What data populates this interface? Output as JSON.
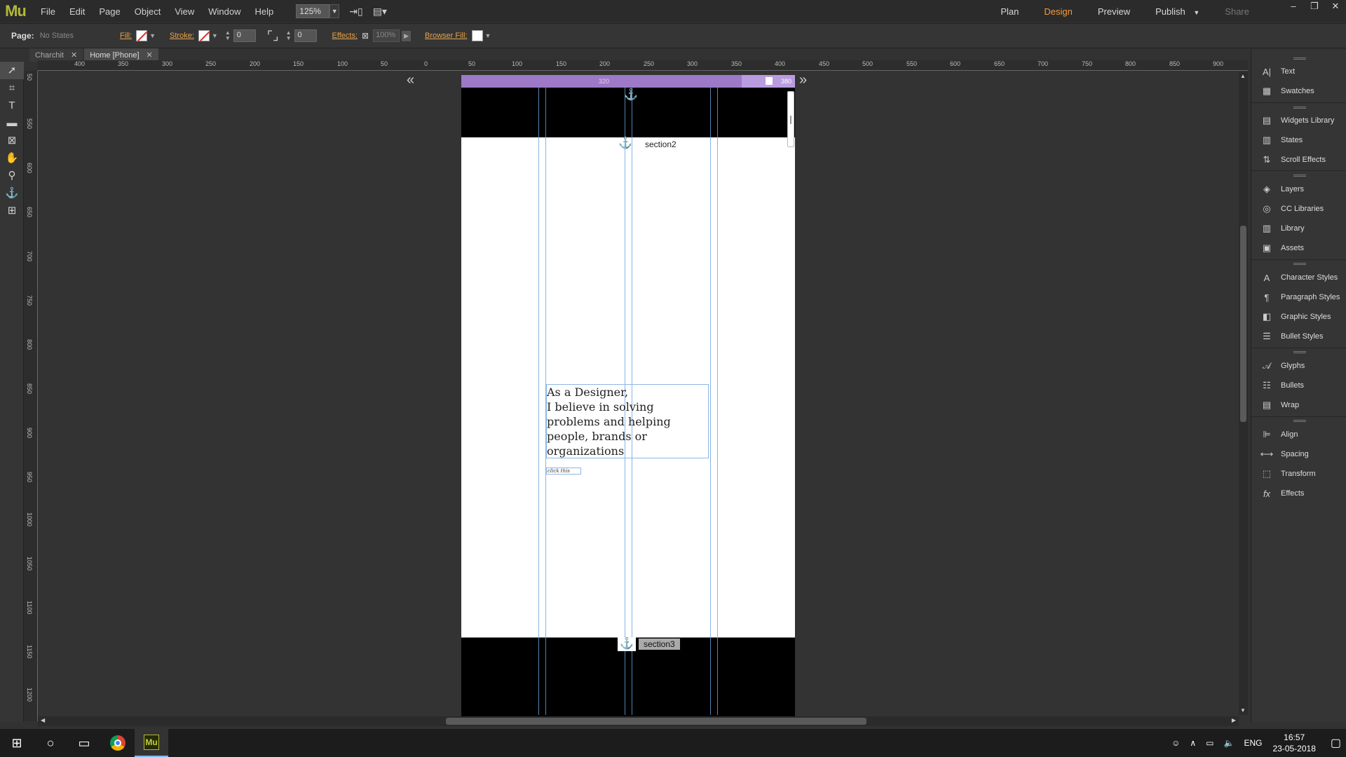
{
  "app": {
    "logo": "Mu"
  },
  "menu": [
    "File",
    "Edit",
    "Page",
    "Object",
    "View",
    "Window",
    "Help"
  ],
  "toolbar": {
    "zoom": "125%"
  },
  "modes": {
    "plan": "Plan",
    "design": "Design",
    "preview": "Preview",
    "publish": "Publish",
    "share": "Share"
  },
  "window_controls": {
    "minimize": "–",
    "restore": "❐",
    "close": "✕"
  },
  "controlbar": {
    "page_label": "Page:",
    "page_state": "No States",
    "fill_label": "Fill:",
    "stroke_label": "Stroke:",
    "stroke_width": "0",
    "corner_radius": "0",
    "effects_label": "Effects:",
    "opacity": "100%",
    "browser_fill_label": "Browser Fill:"
  },
  "tabs": [
    {
      "label": "Charchit",
      "active": false
    },
    {
      "label": "Home [Phone]",
      "active": true
    }
  ],
  "ruler": {
    "horizontal": [
      "400",
      "350",
      "300",
      "250",
      "200",
      "150",
      "100",
      "50",
      "0",
      "50",
      "100",
      "150",
      "200",
      "250",
      "300",
      "350",
      "400",
      "450",
      "500",
      "550",
      "600",
      "650",
      "700",
      "750",
      "800",
      "850",
      "900"
    ],
    "vertical": [
      "50",
      "550",
      "600",
      "650",
      "700",
      "750",
      "800",
      "850",
      "900",
      "950",
      "1000",
      "1050",
      "1100",
      "1150",
      "1200"
    ]
  },
  "breakpoint": {
    "left_value": "320",
    "right_value": "380"
  },
  "canvas": {
    "anchor1_label": "section2",
    "anchor2_label": "section3",
    "text_lines": [
      "As a Designer,",
      "I believe in solving",
      "problems and helping",
      "people, brands or",
      "organizations"
    ],
    "button_text": "click this"
  },
  "right_panel": {
    "groups": [
      [
        "Text",
        "Swatches"
      ],
      [
        "Widgets Library",
        "States",
        "Scroll Effects"
      ],
      [
        "Layers",
        "CC Libraries",
        "Library",
        "Assets"
      ],
      [
        "Character Styles",
        "Paragraph Styles",
        "Graphic Styles",
        "Bullet Styles"
      ],
      [
        "Glyphs",
        "Bullets",
        "Wrap"
      ],
      [
        "Align",
        "Spacing",
        "Transform",
        "Effects"
      ]
    ]
  },
  "taskbar": {
    "language": "ENG",
    "time": "16:57",
    "date": "23-05-2018"
  },
  "colors": {
    "accent": "#f29b39",
    "logo": "#b3b83a",
    "breakpoint": "#9d79c7"
  }
}
